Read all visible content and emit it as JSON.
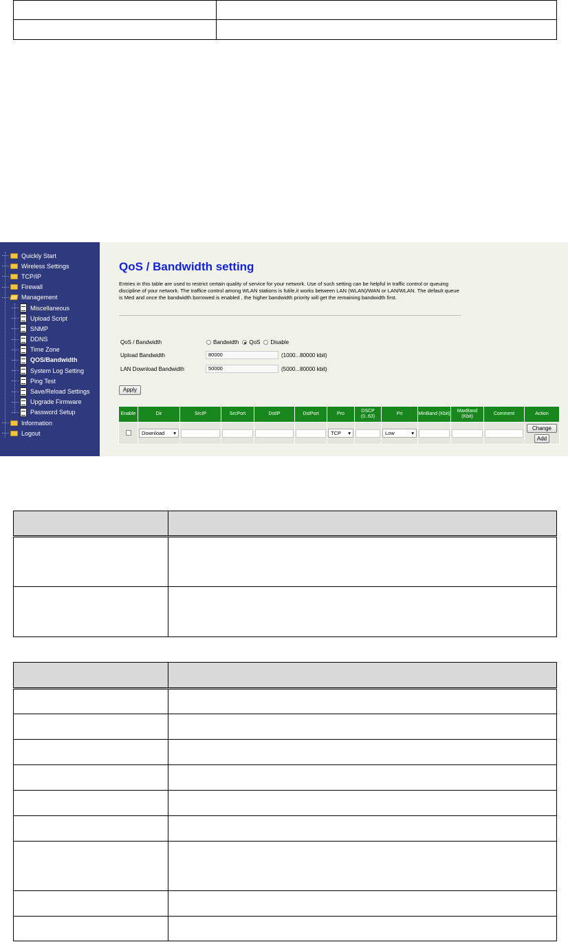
{
  "top_table": {
    "rows": [
      [
        "",
        ""
      ],
      [
        "",
        ""
      ]
    ]
  },
  "sidebar": {
    "items": [
      {
        "label": "Quickly Start"
      },
      {
        "label": "Wireless Settings"
      },
      {
        "label": "TCP/IP"
      },
      {
        "label": "Firewall"
      },
      {
        "label": "Management"
      },
      {
        "label": "Miscellaneous"
      },
      {
        "label": "Upload Script"
      },
      {
        "label": "SNMP"
      },
      {
        "label": "DDNS"
      },
      {
        "label": "Time Zone"
      },
      {
        "label": "QOS/Bandwidth"
      },
      {
        "label": "System Log Setting"
      },
      {
        "label": "Ping Test"
      },
      {
        "label": "Save/Reload Settings"
      },
      {
        "label": "Upgrade Firmware"
      },
      {
        "label": "Password Setup"
      },
      {
        "label": "Information"
      },
      {
        "label": "Logout"
      }
    ]
  },
  "main": {
    "title": "QoS / Bandwidth setting",
    "description": "Entries in this table are used to restrict certain quality of service for your network. Use of such setting can be helpful in traffic control or queuing discipline of your network. The traffice control among WLAN stations is futile,it works between LAN (WLAN)/WAN or LAN/WLAN. The default queue is Med and once the bandwidth borrowed is enabled , the higher bandwidth priority will get the remaining bandwidth first.",
    "qos_label": "QoS / Bandwidth",
    "qos_options": [
      "Bandwidth",
      "QoS",
      "Disable"
    ],
    "qos_selected": "QoS",
    "upload_label": "Upload Bandwidth",
    "upload_value": "80000",
    "upload_hint": "(1000...80000 kbit)",
    "download_label": "LAN Download Bandwidth",
    "download_value": "50000",
    "download_hint": "(5000...80000 kbit)",
    "apply_label": "Apply",
    "columns": [
      "Enable",
      "Dir",
      "SrcIP",
      "SrcPort",
      "DstIP",
      "DstPort",
      "Pro",
      "DSCP (0..63)",
      "Pri",
      "MinBand (Kbit)",
      "MaxBand (Kbit)",
      "Comment",
      "Action"
    ],
    "row": {
      "dir": "Download",
      "pro": "TCP",
      "pri": "Low"
    },
    "change_label": "Change",
    "add_label": "Add"
  },
  "table2": {
    "header": [
      "",
      ""
    ],
    "rows": [
      [
        "",
        ""
      ],
      [
        "",
        ""
      ]
    ]
  },
  "table3": {
    "header": [
      "",
      ""
    ],
    "rows": [
      [
        "",
        ""
      ],
      [
        "",
        ""
      ],
      [
        "",
        ""
      ],
      [
        "",
        ""
      ],
      [
        "",
        ""
      ],
      [
        "",
        ""
      ],
      [
        "",
        ""
      ],
      [
        "",
        ""
      ],
      [
        "",
        ""
      ]
    ]
  }
}
